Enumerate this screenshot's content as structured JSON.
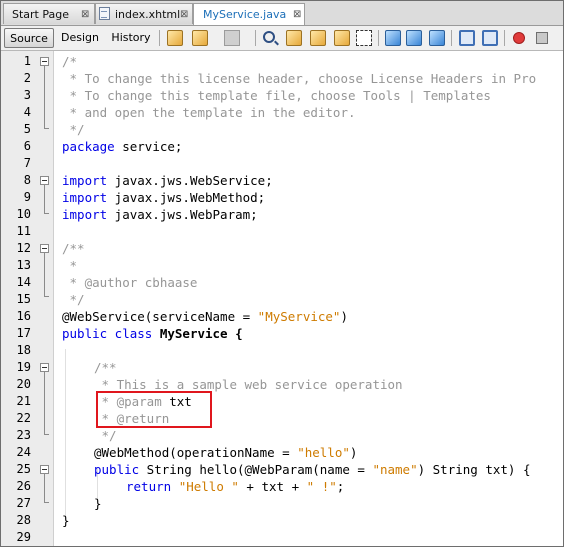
{
  "tabs": [
    {
      "label": "Start Page",
      "close": "⊠",
      "active": false
    },
    {
      "label": "index.xhtml",
      "close": "⊠",
      "active": false
    },
    {
      "label": "MyService.java",
      "close": "⊠",
      "active": true
    }
  ],
  "view_tabs": [
    "Source",
    "Design",
    "History"
  ],
  "toolbar_icons": [
    "last-edit-icon",
    "back-icon",
    "forward-icon",
    "find-icon",
    "find-previous-icon",
    "find-next-icon",
    "toggle-highlight-icon",
    "toggle-rectangular-selection-icon",
    "previous-bookmark-icon",
    "next-bookmark-icon",
    "toggle-bookmark-icon",
    "shift-left-icon",
    "shift-right-icon",
    "start-macro-icon",
    "stop-macro-icon"
  ],
  "colors": {
    "keyword": "#0000e6",
    "string": "#ce7b00",
    "comment": "#969696",
    "highlight_box": "#e0161d",
    "active_tab": "#1c6fb8"
  },
  "code": {
    "l1": "/*",
    "l2": " * To change this license header, choose License Headers in Pro",
    "l3": " * To change this template file, choose Tools | Templates",
    "l4": " * and open the template in the editor.",
    "l5": " */",
    "l6a": "package",
    "l6b": " service;",
    "l8a": "import",
    "l8b": " javax.jws.WebService;",
    "l9a": "import",
    "l9b": " javax.jws.WebMethod;",
    "l10a": "import",
    "l10b": " javax.jws.WebParam;",
    "l12": "/**",
    "l13": " *",
    "l14": " * @author cbhaase",
    "l15": " */",
    "l16a": "@WebService(serviceName = ",
    "l16b": "\"MyService\"",
    "l16c": ")",
    "l17a": "public class",
    "l17b": " MyService {",
    "l19": "/**",
    "l20": " * This is a sample web service operation",
    "l21a": " * @param",
    "l21b": " txt",
    "l22": " * @return",
    "l23": " */",
    "l24a": "@WebMethod(operationName = ",
    "l24b": "\"hello\"",
    "l24c": ")",
    "l25a": "public",
    "l25b": " String hello(@WebParam(name = ",
    "l25c": "\"name\"",
    "l25d": ") String txt) {",
    "l26a": "return",
    "l26b": " ",
    "l26c": "\"Hello \"",
    "l26d": " + txt + ",
    "l26e": "\" !\"",
    "l26f": ";",
    "l27": "}",
    "l28": "}"
  }
}
